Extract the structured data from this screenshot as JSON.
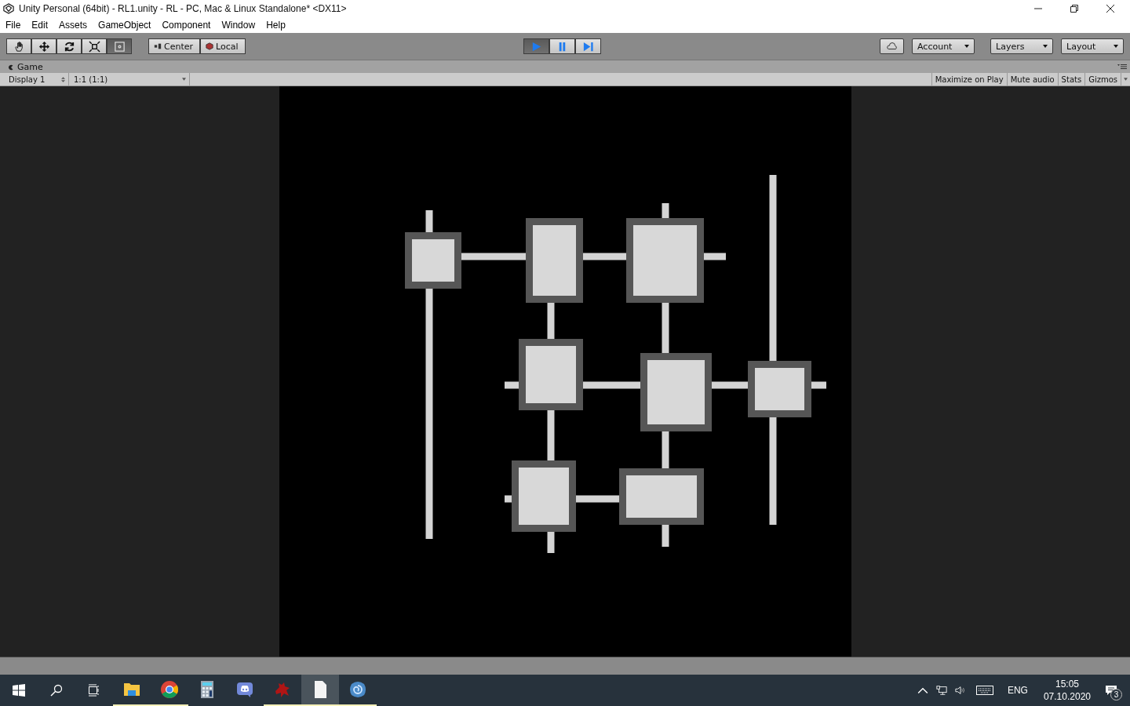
{
  "window": {
    "title": "Unity Personal (64bit) - RL1.unity - RL - PC, Mac & Linux Standalone* <DX11>"
  },
  "menu": [
    "File",
    "Edit",
    "Assets",
    "GameObject",
    "Component",
    "Window",
    "Help"
  ],
  "toolbar": {
    "tools": [
      {
        "kind": "hand",
        "selected": false
      },
      {
        "kind": "move",
        "selected": false
      },
      {
        "kind": "rotate",
        "selected": false
      },
      {
        "kind": "scale",
        "selected": false
      },
      {
        "kind": "rect",
        "selected": true
      }
    ],
    "pivot": [
      "Center",
      "Local"
    ],
    "playback": [
      {
        "kind": "play",
        "selected": true
      },
      {
        "kind": "pause",
        "selected": false
      },
      {
        "kind": "step",
        "selected": false
      }
    ],
    "dropdowns": [
      "Account",
      "Layers",
      "Layout"
    ]
  },
  "game_view": {
    "tab": "Game",
    "display": "Display 1",
    "scale": "1:1 (1:1)",
    "toggles": [
      {
        "label": "Maximize on Play",
        "selected": false
      },
      {
        "label": "Mute audio",
        "selected": false
      },
      {
        "label": "Stats",
        "selected": false
      },
      {
        "label": "Gizmos",
        "selected": false
      }
    ]
  },
  "taskbar": {
    "apps": [
      {
        "kind": "folder",
        "running": true,
        "active": false
      },
      {
        "kind": "chrome",
        "running": true,
        "active": false
      },
      {
        "kind": "calculator",
        "running": false,
        "active": false
      },
      {
        "kind": "discord",
        "running": false,
        "active": false
      },
      {
        "kind": "creature",
        "running": true,
        "active": false
      },
      {
        "kind": "document",
        "running": true,
        "active": true
      },
      {
        "kind": "swirl",
        "running": true,
        "active": false
      }
    ],
    "language": "ENG",
    "time": "15:05",
    "date": "07.10.2020",
    "notifications": "3"
  }
}
